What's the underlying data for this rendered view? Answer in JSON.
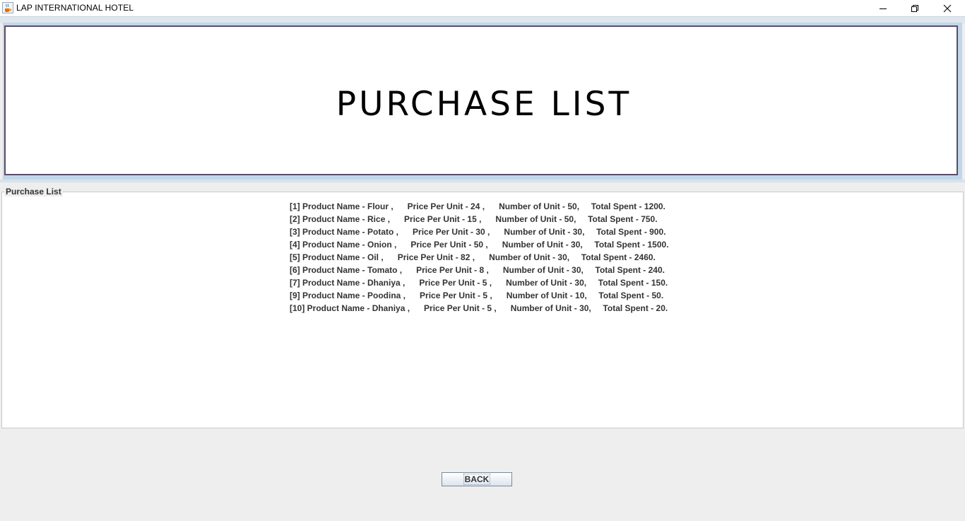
{
  "window": {
    "title": "LAP INTERNATIONAL HOTEL",
    "app_icon": "java-cup-icon",
    "controls": [
      "minimize-icon",
      "restore-icon",
      "close-icon"
    ]
  },
  "header": {
    "title": "PURCHASE LIST"
  },
  "purchase_list": {
    "label": "Purchase List",
    "items": [
      "[1] Product Name - Flour ,      Price Per Unit - 24 ,      Number of Unit - 50,     Total Spent - 1200.",
      "[2] Product Name - Rice ,      Price Per Unit - 15 ,      Number of Unit - 50,     Total Spent - 750.",
      "[3] Product Name - Potato ,      Price Per Unit - 30 ,      Number of Unit - 30,     Total Spent - 900.",
      "[4] Product Name - Onion ,      Price Per Unit - 50 ,      Number of Unit - 30,     Total Spent - 1500.",
      "[5] Product Name - Oil ,      Price Per Unit - 82 ,      Number of Unit - 30,     Total Spent - 2460.",
      "[6] Product Name - Tomato ,      Price Per Unit - 8 ,      Number of Unit - 30,     Total Spent - 240.",
      "[7] Product Name - Dhaniya ,      Price Per Unit - 5 ,      Number of Unit - 30,     Total Spent - 150.",
      "[9] Product Name - Poodina ,      Price Per Unit - 5 ,      Number of Unit - 10,     Total Spent - 50.",
      "[10] Product Name - Dhaniya ,      Price Per Unit - 5 ,      Number of Unit - 30,     Total Spent - 20."
    ]
  },
  "actions": {
    "back_label": "BACK"
  }
}
